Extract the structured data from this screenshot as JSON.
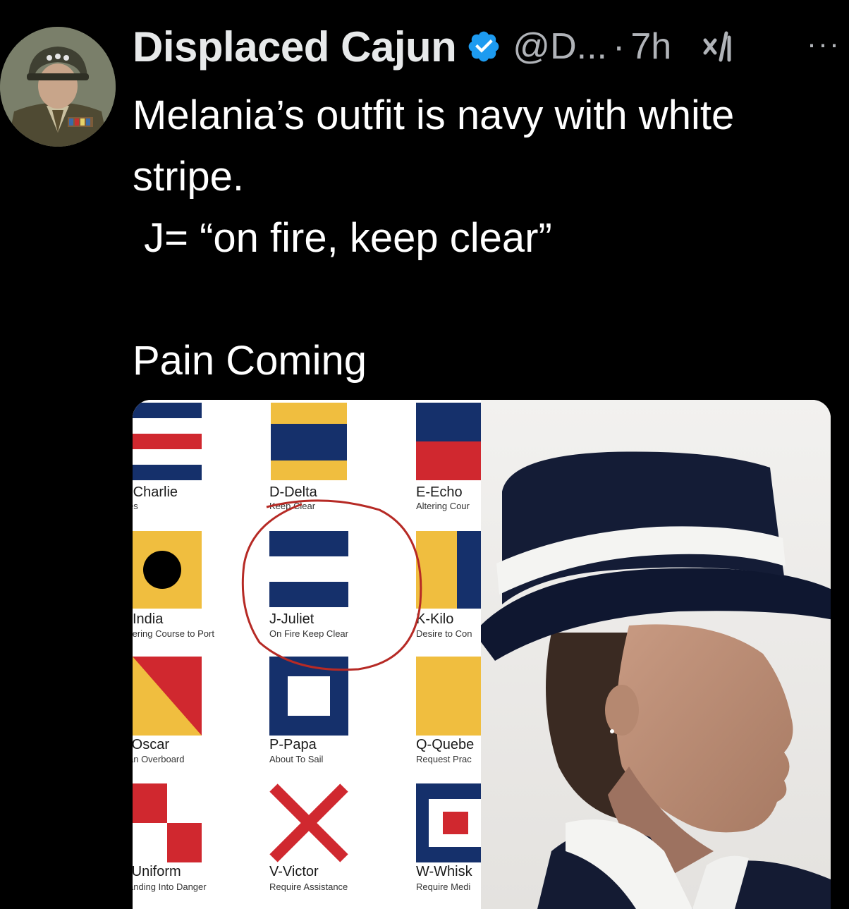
{
  "tweet": {
    "display_name": "Displaced Cajun",
    "handle": "@D...",
    "separator": "·",
    "time": "7h",
    "more": "···",
    "icons": {
      "verified": "verified-badge-icon",
      "grok": "grok-icon",
      "more": "more-options-icon"
    },
    "text": {
      "line1": "Melania’s outfit is navy with white stripe.",
      "line2": " J= “on fire, keep clear”",
      "line3": "Pain Coming"
    }
  },
  "media": {
    "flags": [
      {
        "label": "-Charlie",
        "desc": "es"
      },
      {
        "label": "D-Delta",
        "desc": "Keep Clear"
      },
      {
        "label": "E-Echo",
        "desc": "Altering Cour"
      },
      {
        "label": "India",
        "desc": "tering Course to Port"
      },
      {
        "label": "J-Juliet",
        "desc": "On Fire Keep Clear"
      },
      {
        "label": "K-Kilo",
        "desc": "Desire to Con"
      },
      {
        "label": "-Oscar",
        "desc": "an Overboard"
      },
      {
        "label": "P-Papa",
        "desc": "About To Sail"
      },
      {
        "label": "Q-Quebe",
        "desc": "Request Prac"
      },
      {
        "label": "-Uniform",
        "desc": "anding Into Danger"
      },
      {
        "label": "V-Victor",
        "desc": "Require Assistance"
      },
      {
        "label": "W-Whisk",
        "desc": "Require Medi"
      }
    ],
    "colors": {
      "navy": "#15306b",
      "red": "#d0282f",
      "yellow": "#f0be3f",
      "white": "#ffffff",
      "circle": "#b62a25"
    }
  }
}
